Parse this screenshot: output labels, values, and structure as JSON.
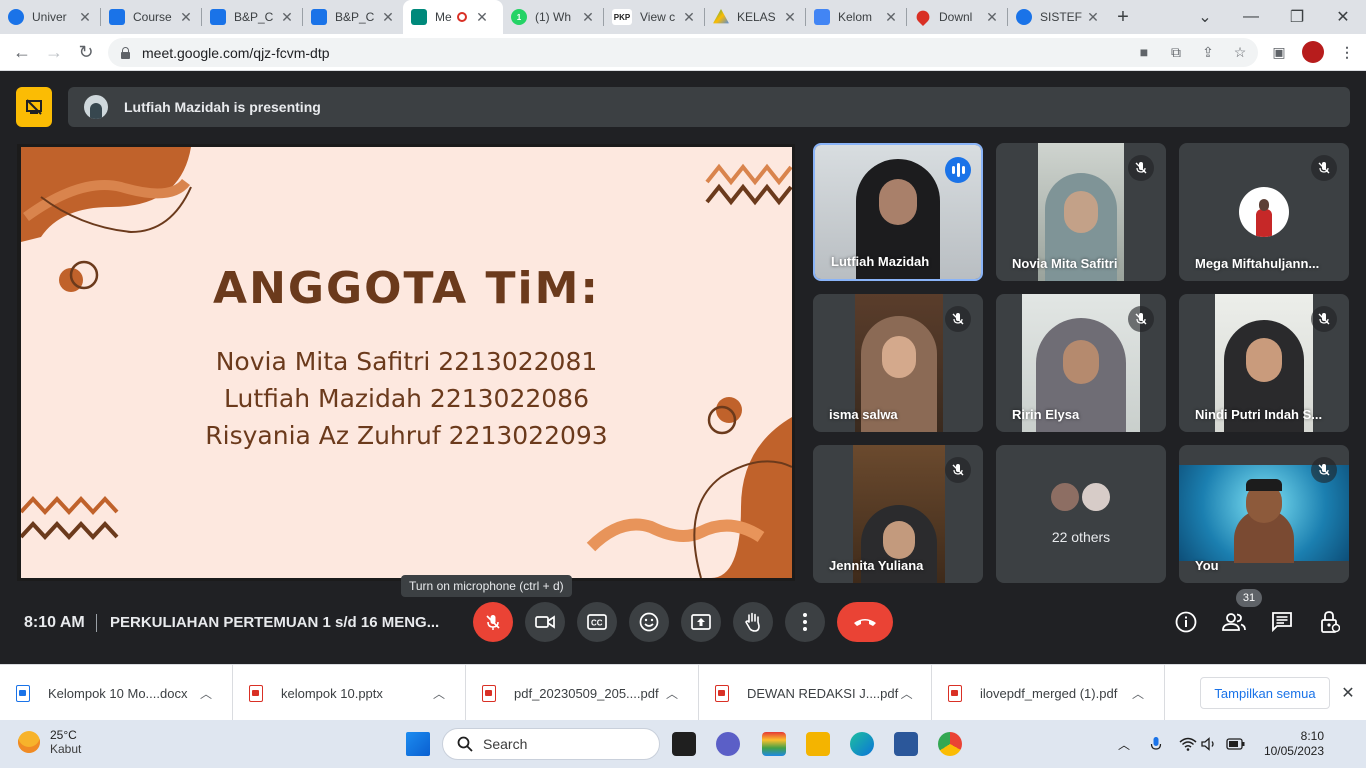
{
  "browser": {
    "tabs": [
      {
        "title": "Univer",
        "color": "#1a73e8"
      },
      {
        "title": "Course",
        "color": "#1a73e8"
      },
      {
        "title": "B&P_C",
        "color": "#1a73e8"
      },
      {
        "title": "B&P_C",
        "color": "#1a73e8"
      },
      {
        "title": "Me",
        "color": "#00897b"
      },
      {
        "title": "(1) Wh",
        "color": "#25d366"
      },
      {
        "title": "View c",
        "color": "#212121",
        "fav_text": "PKP"
      },
      {
        "title": "KELAS",
        "color": "#fbbc04"
      },
      {
        "title": "Kelom",
        "color": "#4285f4"
      },
      {
        "title": "Downl",
        "color": "#d93025"
      },
      {
        "title": "SISTEF",
        "color": "#1a73e8"
      }
    ],
    "url": "meet.google.com/qjz-fcvm-dtp"
  },
  "meet": {
    "presenting_text": "Lutfiah Mazidah is presenting",
    "slide": {
      "title": "ANGGOTA TiM:",
      "lines": [
        "Novia Mita Safitri 2213022081",
        "Lutfiah Mazidah 2213022086",
        "Risyania Az Zuhruf 2213022093"
      ]
    },
    "participants": [
      {
        "name": "Lutfiah Mazidah"
      },
      {
        "name": "Novia Mita Safitri"
      },
      {
        "name": "Mega Miftahuljann..."
      },
      {
        "name": "isma salwa"
      },
      {
        "name": "Ririn Elysa"
      },
      {
        "name": "Nindi Putri Indah S..."
      },
      {
        "name": "Jennita Yuliana"
      },
      {
        "name": "22 others"
      },
      {
        "name": "You"
      }
    ],
    "tooltip": "Turn on microphone (ctrl + d)",
    "time": "8:10 AM",
    "meeting_name": "PERKULIAHAN PERTEMUAN 1 s/d 16 MENG...",
    "participant_count": "31"
  },
  "downloads": {
    "items": [
      {
        "name": "Kelompok 10 Mo....docx",
        "type": "word"
      },
      {
        "name": "kelompok 10.pptx",
        "type": "ppt"
      },
      {
        "name": "pdf_20230509_205....pdf",
        "type": "pdf"
      },
      {
        "name": "DEWAN REDAKSI J....pdf",
        "type": "pdf"
      },
      {
        "name": "ilovepdf_merged (1).pdf",
        "type": "pdf"
      }
    ],
    "show_all": "Tampilkan semua"
  },
  "taskbar": {
    "temperature": "25°C",
    "weather": "Kabut",
    "search": "Search",
    "time": "8:10",
    "date": "10/05/2023"
  }
}
